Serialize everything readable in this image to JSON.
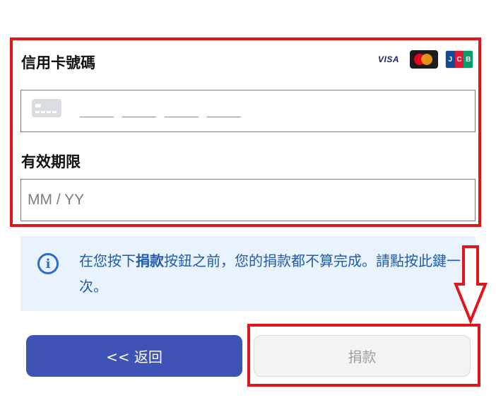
{
  "form": {
    "card_label": "信用卡號碼",
    "card_number_placeholder": "____ ____ ____ ____",
    "expiry_label": "有效期限",
    "expiry_placeholder": "MM / YY"
  },
  "brands": {
    "visa": "VISA",
    "jcb": [
      "J",
      "C",
      "B"
    ]
  },
  "notice": {
    "prefix": "在您按下",
    "highlight": "捐款",
    "suffix": "按鈕之前，您的捐款都不算完成。請點按此鍵一次。"
  },
  "buttons": {
    "back": "<< 返回",
    "donate": "捐款"
  },
  "colors": {
    "highlight_border": "#e0161f",
    "primary_button": "#3f52b5",
    "notice_bg": "#e8f3fd",
    "notice_text": "#215ab1"
  }
}
